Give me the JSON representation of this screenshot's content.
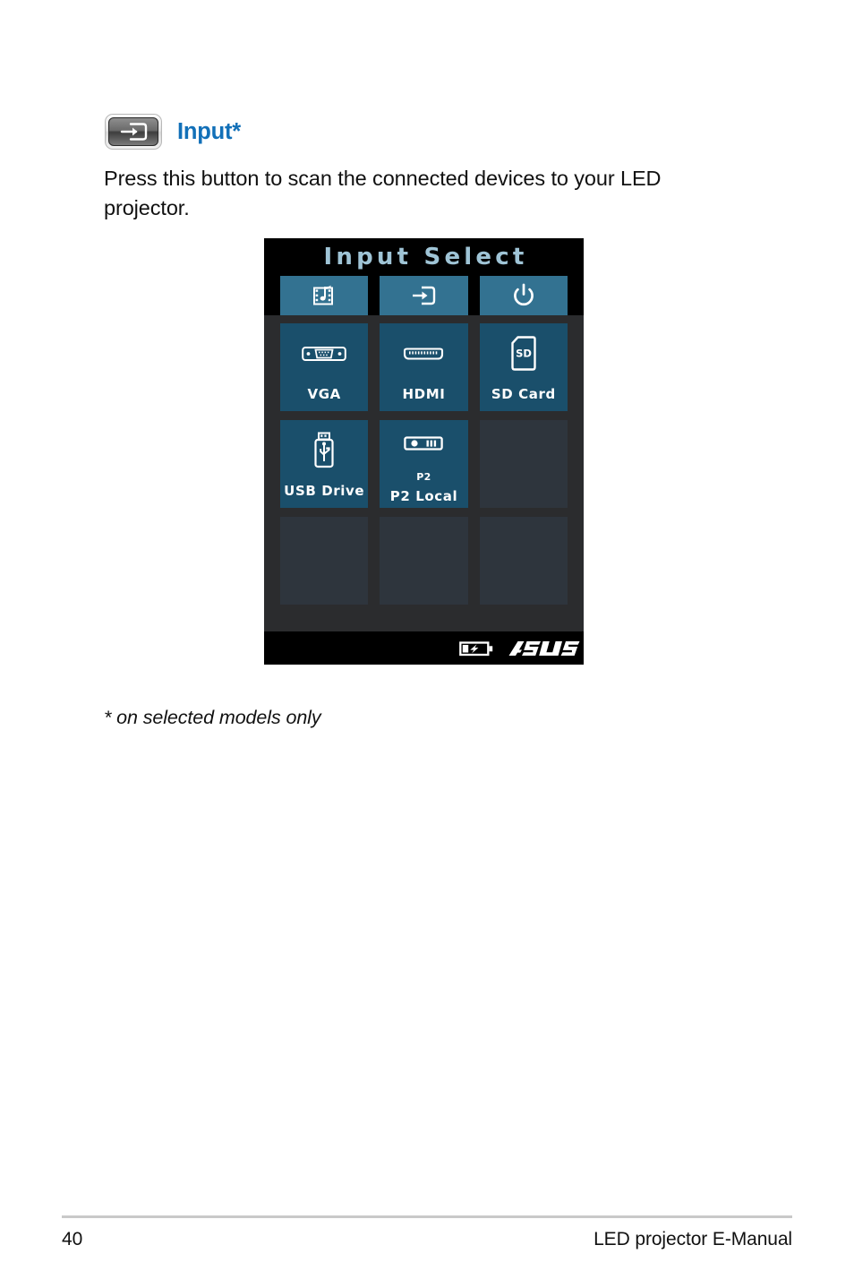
{
  "section": {
    "heading": "Input*",
    "heading_color": "#1270b8",
    "button_icon": "input-source-icon",
    "body": "Press this button to scan the connected devices to your LED projector.",
    "footnote": "* on selected models only"
  },
  "osd": {
    "title": "Input Select",
    "title_color": "#9fc4d6",
    "background_color": "#2b2c2e",
    "tab_color": "#337291",
    "tile_active_color": "#1a4f6b",
    "tile_empty_color": "#2e353d",
    "tabs": [
      {
        "name": "multimedia",
        "icon": "multimedia-film-music-icon"
      },
      {
        "name": "input",
        "icon": "input-source-icon"
      },
      {
        "name": "power",
        "icon": "power-icon"
      }
    ],
    "tiles": [
      {
        "label": "VGA",
        "icon": "vga-connector-icon",
        "sub": "",
        "filled": true
      },
      {
        "label": "HDMI",
        "icon": "hdmi-connector-icon",
        "sub": "",
        "filled": true
      },
      {
        "label": "SD Card",
        "icon": "sd-card-icon",
        "sub": "",
        "filled": true
      },
      {
        "label": "USB Drive",
        "icon": "usb-drive-icon",
        "sub": "",
        "filled": true
      },
      {
        "label": "P2 Local",
        "icon": "projector-icon",
        "sub": "P2",
        "filled": true
      },
      {
        "label": "",
        "icon": "",
        "sub": "",
        "filled": false
      },
      {
        "label": "",
        "icon": "",
        "sub": "",
        "filled": false
      },
      {
        "label": "",
        "icon": "",
        "sub": "",
        "filled": false
      },
      {
        "label": "",
        "icon": "",
        "sub": "",
        "filled": false
      }
    ],
    "footer": {
      "battery_icon": "battery-charging-icon",
      "brand_logo": "asus-logo"
    }
  },
  "page_footer": {
    "page_number": "40",
    "manual_title": "LED projector E-Manual"
  }
}
